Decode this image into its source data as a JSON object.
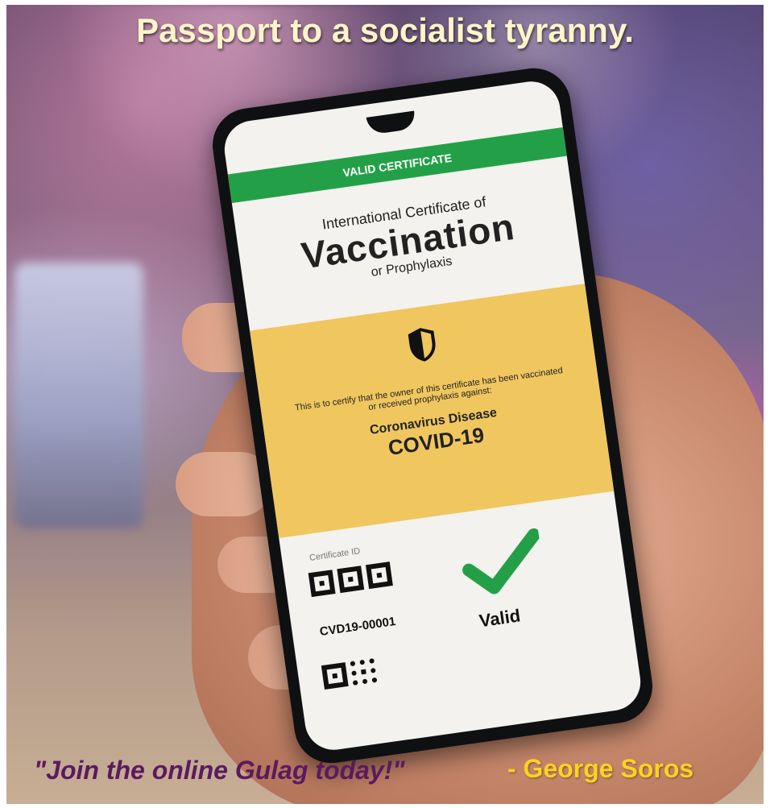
{
  "headline": "Passport to a socialist tyranny.",
  "phone": {
    "banner": "VALID CERTIFICATE",
    "title_line1": "International Certificate of",
    "title_line2": "Vaccination",
    "title_line3": "or Prophylaxis",
    "cert_text": "This is to certify that the owner of this certificate has been vaccinated or received prophylaxis against:",
    "disease": "Coronavirus Disease",
    "covid": "COVID-19",
    "cert_id_label": "Certificate ID",
    "cert_id": "CVD19-00001",
    "valid_word": "Valid",
    "colors": {
      "green": "#23a047",
      "yellow": "#f0c65f"
    },
    "icons": [
      "shield-icon",
      "check-icon",
      "qr-code-icon"
    ]
  },
  "caption": {
    "quote": "\"Join the online Gulag today!\"",
    "author": "- George Soros",
    "colors": {
      "quote": "#5a1a5e",
      "author": "#ffd21f"
    }
  }
}
